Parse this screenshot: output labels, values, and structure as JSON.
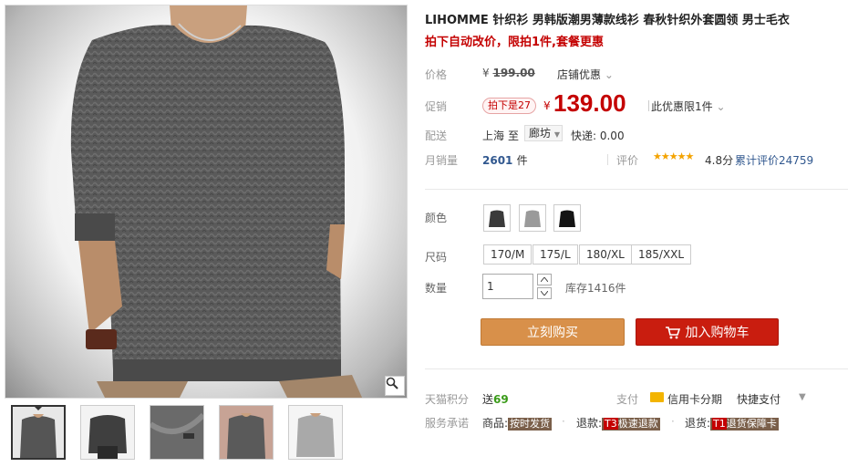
{
  "product": {
    "title": "LIHOMME 针织衫 男韩版潮男薄款线衫 春秋针织外套圆领 男士毛衣",
    "subtitle": "拍下自动改价，限拍1件,套餐更惠"
  },
  "price": {
    "label": "价格",
    "currency": "¥",
    "original": "199.00",
    "shop_discount": "店铺优惠",
    "promo_label": "促销",
    "promo_tag": "拍下是27",
    "current": "139.00",
    "limit_note": "此优惠限1件"
  },
  "shipping": {
    "label": "配送",
    "from": "上海",
    "to_word": "至",
    "city": "廊坊",
    "express": "快递: 0.00"
  },
  "sales": {
    "label": "月销量",
    "count": "2601",
    "unit": "件",
    "rating_label": "评价",
    "stars": 4.8,
    "stars_text": "★★★★★",
    "score": "4.8分",
    "reviews": "累计评价24759"
  },
  "options": {
    "color_label": "颜色",
    "colors": [
      {
        "name": "dark-gray",
        "hex": "#3a3a3a"
      },
      {
        "name": "light-gray",
        "hex": "#9a9a9a"
      },
      {
        "name": "black",
        "hex": "#141414"
      }
    ],
    "size_label": "尺码",
    "sizes": [
      "170/M",
      "175/L",
      "180/XL",
      "185/XXL"
    ],
    "qty_label": "数量",
    "qty_value": "1",
    "stock": "库存1416件"
  },
  "actions": {
    "buy_now": "立刻购买",
    "add_to_cart": "加入购物车"
  },
  "points": {
    "label": "天猫积分",
    "prefix": "送",
    "value": "69",
    "pay_label": "支付",
    "card_installment": "信用卡分期",
    "quick_pay": "快捷支付",
    "quick_pay_arrow": "▼"
  },
  "service": {
    "label": "服务承诺",
    "goods_prefix": "商品:",
    "goods_tag": "按时发货",
    "refund_prefix": "退款:",
    "refund_code": "T3",
    "refund_tag": "极速退款",
    "return_prefix": "退货:",
    "return_code": "T1",
    "return_tag": "退货保障卡",
    "sep": "·"
  },
  "icons": {
    "zoom": "magnifier-icon",
    "cart": "cart-icon",
    "card": "credit-card-icon",
    "chevron": "chevron-down-icon"
  },
  "colors": {
    "price_red": "#c40000",
    "buy_now": "#d8904a",
    "add_cart": "#c91d0f",
    "link_blue": "#31588f",
    "star": "#f4a300"
  }
}
